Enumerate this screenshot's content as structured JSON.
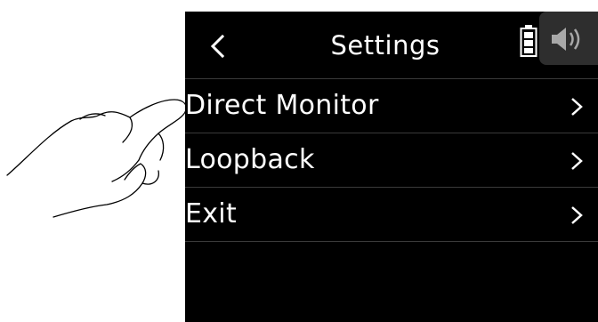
{
  "header": {
    "title": "Settings",
    "back_icon": "chevron-left-icon",
    "battery_icon": "battery-icon",
    "speaker_icon": "speaker-icon"
  },
  "menu": {
    "items": [
      {
        "label": "Direct Monitor",
        "icon": "chevron-right-icon"
      },
      {
        "label": "Loopback",
        "icon": "chevron-right-icon"
      },
      {
        "label": "Exit",
        "icon": "chevron-right-icon"
      }
    ]
  },
  "colors": {
    "background": "#000000",
    "text": "#ffffff",
    "divider": "#3a3a3a",
    "speaker_tab": "#2e2e2e"
  }
}
